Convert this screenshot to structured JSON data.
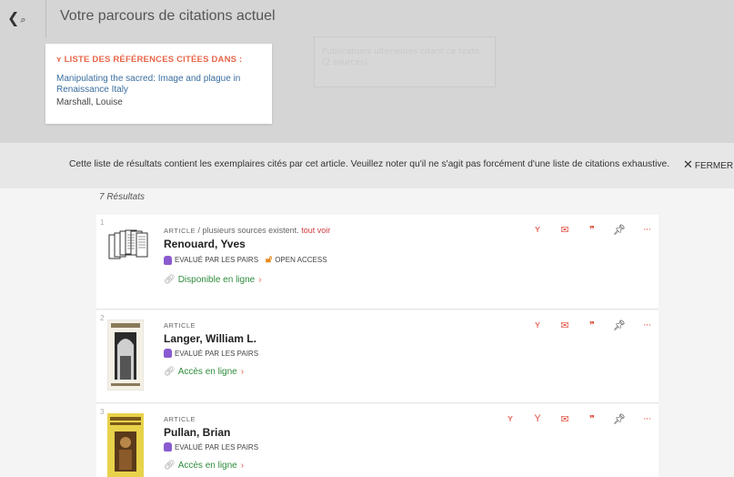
{
  "header": {
    "title": "Votre parcours de citations actuel",
    "ghost_text": "Publications ultérieures citant ce texte (2 sources)"
  },
  "citation_card": {
    "heading": "LISTE DES RÉFÉRENCES CITÉES DANS :",
    "title": "Manipulating the sacred: Image and plague in Renaissance Italy",
    "author": "Marshall, Louise"
  },
  "notice": {
    "text": "Cette liste de résultats contient les exemplaires cités par cet article. Veuillez noter qu'il ne s'agit pas forcément d'une liste de citations exhaustive.",
    "close_label": "FERMER"
  },
  "results": {
    "count_label": "7 Résultats",
    "items": [
      {
        "num": "1",
        "type": "ARTICLE",
        "extra": " / plusieurs sources existent.",
        "see_all": "tout voir",
        "title": "Renouard, Yves",
        "peer": "EVALUÉ PAR LES PAIRS",
        "oa": "OPEN ACCESS",
        "avail": "Disponible en ligne"
      },
      {
        "num": "2",
        "type": "ARTICLE",
        "title": "Langer, William L.",
        "peer": "EVALUÉ PAR LES PAIRS",
        "avail": "Accès en ligne"
      },
      {
        "num": "3",
        "type": "ARTICLE",
        "title": "Pullan, Brian",
        "peer": "EVALUÉ PAR LES PAIRS",
        "avail": "Accès en ligne"
      }
    ]
  },
  "icons": {
    "cite": "Y",
    "mail": "✉",
    "quote": "❞",
    "pin": "✚",
    "more": "···",
    "link": "⛓",
    "chev": "›"
  },
  "colors": {
    "accent": "#e05040",
    "link_green": "#2f8c3d",
    "peer_purple": "#8a5bd0",
    "oa_orange": "#e88a1c"
  }
}
